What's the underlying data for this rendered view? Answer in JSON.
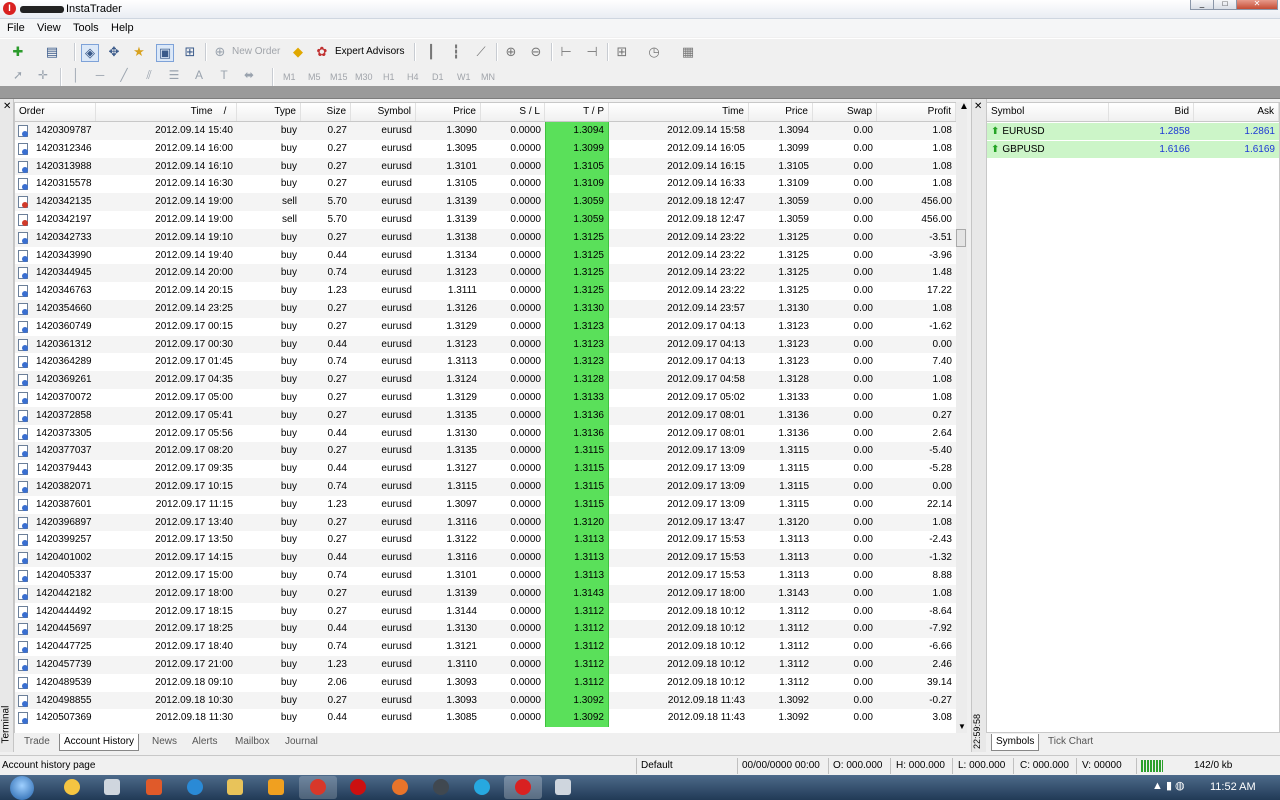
{
  "app": {
    "title": "InstaTrader"
  },
  "menu": [
    "File",
    "View",
    "Tools",
    "Help"
  ],
  "toolbar": {
    "new_order": "New Order",
    "expert_advisors": "Expert Advisors",
    "timeframes": [
      "M1",
      "M5",
      "M15",
      "M30",
      "H1",
      "H4",
      "D1",
      "W1",
      "MN"
    ]
  },
  "terminal": {
    "label": "Terminal",
    "columns": [
      "Order",
      "Time",
      "Type",
      "Size",
      "Symbol",
      "Price",
      "S / L",
      "T / P",
      "Time",
      "Price",
      "Swap",
      "Profit"
    ],
    "sort_marker": "/",
    "rows": [
      [
        "1420309787",
        "2012.09.14 15:40",
        "buy",
        "0.27",
        "eurusd",
        "1.3090",
        "0.0000",
        "1.3094",
        "2012.09.14 15:58",
        "1.3094",
        "0.00",
        "1.08"
      ],
      [
        "1420312346",
        "2012.09.14 16:00",
        "buy",
        "0.27",
        "eurusd",
        "1.3095",
        "0.0000",
        "1.3099",
        "2012.09.14 16:05",
        "1.3099",
        "0.00",
        "1.08"
      ],
      [
        "1420313988",
        "2012.09.14 16:10",
        "buy",
        "0.27",
        "eurusd",
        "1.3101",
        "0.0000",
        "1.3105",
        "2012.09.14 16:15",
        "1.3105",
        "0.00",
        "1.08"
      ],
      [
        "1420315578",
        "2012.09.14 16:30",
        "buy",
        "0.27",
        "eurusd",
        "1.3105",
        "0.0000",
        "1.3109",
        "2012.09.14 16:33",
        "1.3109",
        "0.00",
        "1.08"
      ],
      [
        "1420342135",
        "2012.09.14 19:00",
        "sell",
        "5.70",
        "eurusd",
        "1.3139",
        "0.0000",
        "1.3059",
        "2012.09.18 12:47",
        "1.3059",
        "0.00",
        "456.00"
      ],
      [
        "1420342197",
        "2012.09.14 19:00",
        "sell",
        "5.70",
        "eurusd",
        "1.3139",
        "0.0000",
        "1.3059",
        "2012.09.18 12:47",
        "1.3059",
        "0.00",
        "456.00"
      ],
      [
        "1420342733",
        "2012.09.14 19:10",
        "buy",
        "0.27",
        "eurusd",
        "1.3138",
        "0.0000",
        "1.3125",
        "2012.09.14 23:22",
        "1.3125",
        "0.00",
        "-3.51"
      ],
      [
        "1420343990",
        "2012.09.14 19:40",
        "buy",
        "0.44",
        "eurusd",
        "1.3134",
        "0.0000",
        "1.3125",
        "2012.09.14 23:22",
        "1.3125",
        "0.00",
        "-3.96"
      ],
      [
        "1420344945",
        "2012.09.14 20:00",
        "buy",
        "0.74",
        "eurusd",
        "1.3123",
        "0.0000",
        "1.3125",
        "2012.09.14 23:22",
        "1.3125",
        "0.00",
        "1.48"
      ],
      [
        "1420346763",
        "2012.09.14 20:15",
        "buy",
        "1.23",
        "eurusd",
        "1.3111",
        "0.0000",
        "1.3125",
        "2012.09.14 23:22",
        "1.3125",
        "0.00",
        "17.22"
      ],
      [
        "1420354660",
        "2012.09.14 23:25",
        "buy",
        "0.27",
        "eurusd",
        "1.3126",
        "0.0000",
        "1.3130",
        "2012.09.14 23:57",
        "1.3130",
        "0.00",
        "1.08"
      ],
      [
        "1420360749",
        "2012.09.17 00:15",
        "buy",
        "0.27",
        "eurusd",
        "1.3129",
        "0.0000",
        "1.3123",
        "2012.09.17 04:13",
        "1.3123",
        "0.00",
        "-1.62"
      ],
      [
        "1420361312",
        "2012.09.17 00:30",
        "buy",
        "0.44",
        "eurusd",
        "1.3123",
        "0.0000",
        "1.3123",
        "2012.09.17 04:13",
        "1.3123",
        "0.00",
        "0.00"
      ],
      [
        "1420364289",
        "2012.09.17 01:45",
        "buy",
        "0.74",
        "eurusd",
        "1.3113",
        "0.0000",
        "1.3123",
        "2012.09.17 04:13",
        "1.3123",
        "0.00",
        "7.40"
      ],
      [
        "1420369261",
        "2012.09.17 04:35",
        "buy",
        "0.27",
        "eurusd",
        "1.3124",
        "0.0000",
        "1.3128",
        "2012.09.17 04:58",
        "1.3128",
        "0.00",
        "1.08"
      ],
      [
        "1420370072",
        "2012.09.17 05:00",
        "buy",
        "0.27",
        "eurusd",
        "1.3129",
        "0.0000",
        "1.3133",
        "2012.09.17 05:02",
        "1.3133",
        "0.00",
        "1.08"
      ],
      [
        "1420372858",
        "2012.09.17 05:41",
        "buy",
        "0.27",
        "eurusd",
        "1.3135",
        "0.0000",
        "1.3136",
        "2012.09.17 08:01",
        "1.3136",
        "0.00",
        "0.27"
      ],
      [
        "1420373305",
        "2012.09.17 05:56",
        "buy",
        "0.44",
        "eurusd",
        "1.3130",
        "0.0000",
        "1.3136",
        "2012.09.17 08:01",
        "1.3136",
        "0.00",
        "2.64"
      ],
      [
        "1420377037",
        "2012.09.17 08:20",
        "buy",
        "0.27",
        "eurusd",
        "1.3135",
        "0.0000",
        "1.3115",
        "2012.09.17 13:09",
        "1.3115",
        "0.00",
        "-5.40"
      ],
      [
        "1420379443",
        "2012.09.17 09:35",
        "buy",
        "0.44",
        "eurusd",
        "1.3127",
        "0.0000",
        "1.3115",
        "2012.09.17 13:09",
        "1.3115",
        "0.00",
        "-5.28"
      ],
      [
        "1420382071",
        "2012.09.17 10:15",
        "buy",
        "0.74",
        "eurusd",
        "1.3115",
        "0.0000",
        "1.3115",
        "2012.09.17 13:09",
        "1.3115",
        "0.00",
        "0.00"
      ],
      [
        "1420387601",
        "2012.09.17 11:15",
        "buy",
        "1.23",
        "eurusd",
        "1.3097",
        "0.0000",
        "1.3115",
        "2012.09.17 13:09",
        "1.3115",
        "0.00",
        "22.14"
      ],
      [
        "1420396897",
        "2012.09.17 13:40",
        "buy",
        "0.27",
        "eurusd",
        "1.3116",
        "0.0000",
        "1.3120",
        "2012.09.17 13:47",
        "1.3120",
        "0.00",
        "1.08"
      ],
      [
        "1420399257",
        "2012.09.17 13:50",
        "buy",
        "0.27",
        "eurusd",
        "1.3122",
        "0.0000",
        "1.3113",
        "2012.09.17 15:53",
        "1.3113",
        "0.00",
        "-2.43"
      ],
      [
        "1420401002",
        "2012.09.17 14:15",
        "buy",
        "0.44",
        "eurusd",
        "1.3116",
        "0.0000",
        "1.3113",
        "2012.09.17 15:53",
        "1.3113",
        "0.00",
        "-1.32"
      ],
      [
        "1420405337",
        "2012.09.17 15:00",
        "buy",
        "0.74",
        "eurusd",
        "1.3101",
        "0.0000",
        "1.3113",
        "2012.09.17 15:53",
        "1.3113",
        "0.00",
        "8.88"
      ],
      [
        "1420442182",
        "2012.09.17 18:00",
        "buy",
        "0.27",
        "eurusd",
        "1.3139",
        "0.0000",
        "1.3143",
        "2012.09.17 18:00",
        "1.3143",
        "0.00",
        "1.08"
      ],
      [
        "1420444492",
        "2012.09.17 18:15",
        "buy",
        "0.27",
        "eurusd",
        "1.3144",
        "0.0000",
        "1.3112",
        "2012.09.18 10:12",
        "1.3112",
        "0.00",
        "-8.64"
      ],
      [
        "1420445697",
        "2012.09.17 18:25",
        "buy",
        "0.44",
        "eurusd",
        "1.3130",
        "0.0000",
        "1.3112",
        "2012.09.18 10:12",
        "1.3112",
        "0.00",
        "-7.92"
      ],
      [
        "1420447725",
        "2012.09.17 18:40",
        "buy",
        "0.74",
        "eurusd",
        "1.3121",
        "0.0000",
        "1.3112",
        "2012.09.18 10:12",
        "1.3112",
        "0.00",
        "-6.66"
      ],
      [
        "1420457739",
        "2012.09.17 21:00",
        "buy",
        "1.23",
        "eurusd",
        "1.3110",
        "0.0000",
        "1.3112",
        "2012.09.18 10:12",
        "1.3112",
        "0.00",
        "2.46"
      ],
      [
        "1420489539",
        "2012.09.18 09:10",
        "buy",
        "2.06",
        "eurusd",
        "1.3093",
        "0.0000",
        "1.3112",
        "2012.09.18 10:12",
        "1.3112",
        "0.00",
        "39.14"
      ],
      [
        "1420498855",
        "2012.09.18 10:30",
        "buy",
        "0.27",
        "eurusd",
        "1.3093",
        "0.0000",
        "1.3092",
        "2012.09.18 11:43",
        "1.3092",
        "0.00",
        "-0.27"
      ],
      [
        "1420507369",
        "2012.09.18 11:30",
        "buy",
        "0.44",
        "eurusd",
        "1.3085",
        "0.0000",
        "1.3092",
        "2012.09.18 11:43",
        "1.3092",
        "0.00",
        "3.08"
      ]
    ],
    "tabs": [
      "Trade",
      "Account History",
      "News",
      "Alerts",
      "Mailbox",
      "Journal"
    ],
    "active_tab": "Account History"
  },
  "market_watch": {
    "columns": [
      "Symbol",
      "Bid",
      "Ask"
    ],
    "rows": [
      {
        "symbol": "EURUSD",
        "bid": "1.2858",
        "ask": "1.2861"
      },
      {
        "symbol": "GBPUSD",
        "bid": "1.6166",
        "ask": "1.6169"
      }
    ],
    "time": "22:59:58",
    "tabs": [
      "Symbols",
      "Tick Chart"
    ]
  },
  "status": {
    "left": "Account history page",
    "profile": "Default",
    "datetime": "00/00/0000 00:00",
    "open": "O: 000.000",
    "high": "H: 000.000",
    "low": "L: 000.000",
    "close": "C: 000.000",
    "volume": "V: 00000",
    "traffic": "142/0 kb"
  },
  "taskbar": {
    "clock": "11:52 AM"
  },
  "colors": {
    "tp_highlight": "#5ae05a",
    "market_row": "#ccf5c8",
    "bid_ask": "#1d38d6"
  }
}
